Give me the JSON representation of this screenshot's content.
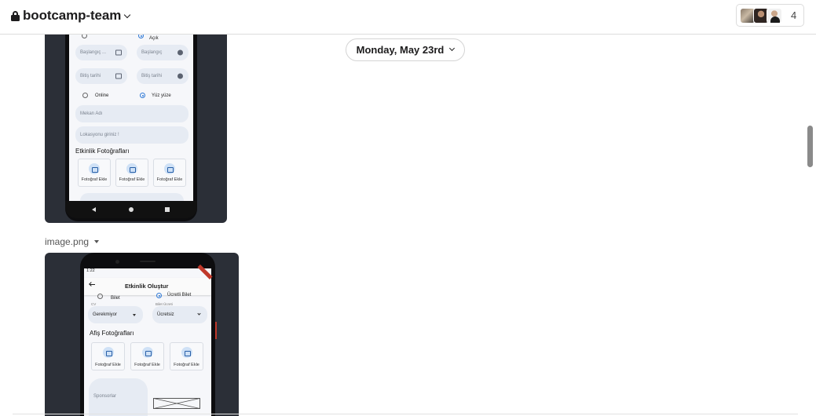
{
  "header": {
    "channel_name": "bootcamp-team",
    "member_count": "4"
  },
  "day_divider": {
    "label": "Monday, May 23rd"
  },
  "attachment1": {
    "phone_screen": {
      "top_radio_left": "",
      "top_radio_right": "Açık",
      "start_date": "Başlangıç ...",
      "start_time": "Başlangıç",
      "end_date": "Bitiş tarihi",
      "end_time": "Bitiş tarihi",
      "radio_online": "Online",
      "radio_in_person": "Yüz yüze",
      "venue_placeholder": "Mekan Adı",
      "location_placeholder": "Lokasyonu giriniz !",
      "photos_heading": "Etkinlik Fotoğrafları",
      "photo_add": [
        "Fotoğraf Ekle",
        "Fotoğraf Ekle",
        "Fotoğraf Ekle"
      ]
    }
  },
  "attachment2": {
    "file_name": "image.png",
    "phone_screen": {
      "status_time": "1:22",
      "title": "Etkinlik Oluştur",
      "ticket_radio_left": "Bilet",
      "ticket_radio_right": "Ücretli Bilet",
      "cv_label": "CV",
      "cv_value": "Gerekmiyor",
      "ticket_fee_label": "Bilet Ücreti",
      "ticket_fee_value": "Ücretsiz",
      "poster_heading": "Afiş Fotoğrafları",
      "photo_add": [
        "Fotoğraf Ekle",
        "Fotoğraf Ekle",
        "Fotoğraf Ekle"
      ],
      "sponsors_label": "Sponsorlar"
    }
  },
  "colors": {
    "accent": "#2f79d6",
    "field_bg": "#e6ebf3",
    "shot_bg": "#2b2f37"
  },
  "icons": [
    "lock-icon",
    "chevron-down-icon",
    "caret-down-icon",
    "calendar-icon",
    "clock-icon",
    "camera-icon",
    "back-arrow-icon"
  ]
}
